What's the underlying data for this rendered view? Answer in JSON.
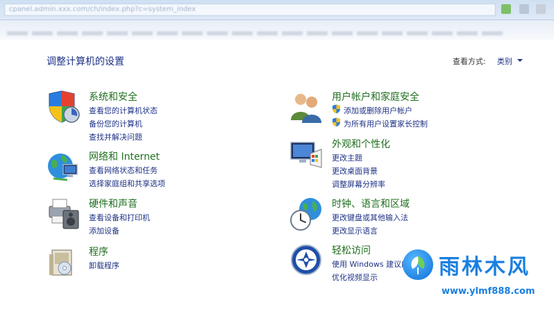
{
  "address_bar": "cpanel.admin.xxx.com/ch/index.php?c=system_index",
  "header": {
    "title": "调整计算机的设置",
    "view_by_label": "查看方式:",
    "view_by_value": "类别"
  },
  "categories": {
    "system": {
      "title": "系统和安全",
      "links": [
        "查看您的计算机状态",
        "备份您的计算机",
        "查找并解决问题"
      ]
    },
    "network": {
      "title": "网络和 Internet",
      "links": [
        "查看网络状态和任务",
        "选择家庭组和共享选项"
      ]
    },
    "hardware": {
      "title": "硬件和声音",
      "links": [
        "查看设备和打印机",
        "添加设备"
      ]
    },
    "programs": {
      "title": "程序",
      "links": [
        "卸载程序"
      ]
    },
    "users": {
      "title": "用户帐户和家庭安全",
      "links": [
        "添加或删除用户帐户",
        "为所有用户设置家长控制"
      ]
    },
    "appearance": {
      "title": "外观和个性化",
      "links": [
        "更改主题",
        "更改桌面背景",
        "调整屏幕分辨率"
      ]
    },
    "clock": {
      "title": "时钟、语言和区域",
      "links": [
        "更改键盘或其他输入法",
        "更改显示语言"
      ]
    },
    "ease": {
      "title": "轻松访问",
      "links": [
        "使用 Windows 建议的设置",
        "优化视频显示"
      ]
    }
  },
  "watermark": {
    "title": "雨林木风",
    "url": "www.ylmf888.com"
  },
  "colors": {
    "link": "#1e3287",
    "category_title": "#1e6e1e",
    "watermark": "#1a7fe0"
  }
}
